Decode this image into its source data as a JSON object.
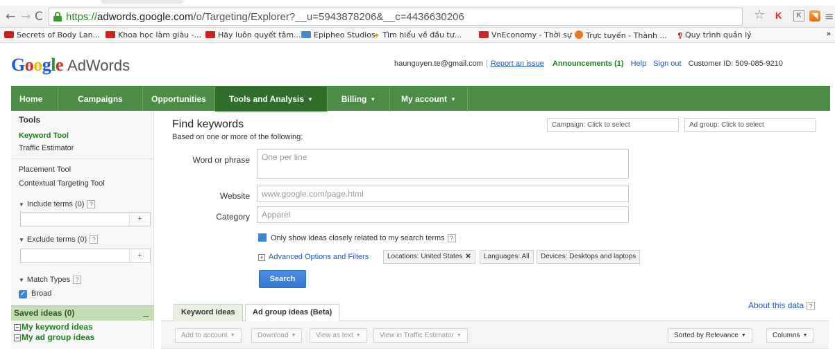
{
  "browser": {
    "url_scheme": "https://",
    "url_host": "adwords.google.com",
    "url_path": "/o/Targeting/Explorer?__u=5943878206&__c=4436630206",
    "bookmarks": [
      "Secrets of Body Lan...",
      "Khoa học làm giàu -...",
      "Hãy luôn quyết tâm...",
      "Epipheo Studios",
      "Tìm hiểu về đầu tư...",
      "VnEconomy - Thời sự",
      "Trực tuyến - Thành ...",
      "Quy trình quản lý"
    ],
    "more": "»"
  },
  "header": {
    "logo_google": "Google",
    "logo_product": "AdWords",
    "email": "haunguyen.te@gmail.com",
    "report_issue": "Report an issue",
    "announcements": "Announcements (1)",
    "help": "Help",
    "sign_out": "Sign out",
    "customer_id": "Customer ID: 509-085-9210"
  },
  "nav": {
    "items": [
      "Home",
      "Campaigns",
      "Opportunities",
      "Tools and Analysis",
      "Billing",
      "My account"
    ],
    "active": "Tools and Analysis"
  },
  "sidebar": {
    "title": "Tools",
    "keyword_tool": "Keyword Tool",
    "traffic_estimator": "Traffic Estimator",
    "placement_tool": "Placement Tool",
    "contextual_tool": "Contextual Targeting Tool",
    "include_terms": "Include terms (0)",
    "exclude_terms": "Exclude terms (0)",
    "plus": "+",
    "match_types": "Match Types",
    "broad": "Broad",
    "help_mark": "?",
    "saved_ideas": "Saved ideas (0)",
    "minimize": "_",
    "my_keyword_ideas": "My keyword ideas",
    "my_ad_group_ideas": "My ad group ideas"
  },
  "main": {
    "title": "Find keywords",
    "subtitle": "Based on one or more of the following:",
    "campaign_select": "Campaign: Click to select",
    "adgroup_select": "Ad group: Click to select",
    "word_label": "Word or phrase",
    "word_placeholder": "One per line",
    "website_label": "Website",
    "website_placeholder": "www.google.com/page.html",
    "category_label": "Category",
    "category_placeholder": "Apparel",
    "closely_related": "Only show ideas closely related to my search terms",
    "advanced": "Advanced Options and Filters",
    "chip_locations": "Locations: United States",
    "chip_languages": "Languages: All",
    "chip_devices": "Devices: Desktops and laptops",
    "search_button": "Search",
    "tab_keyword": "Keyword ideas",
    "tab_adgroup": "Ad group ideas (Beta)",
    "about_data": "About this data",
    "toolbar": {
      "add_to_account": "Add to account",
      "download": "Download",
      "view_as_text": "View as text",
      "view_traffic": "View in Traffic Estimator",
      "sorted": "Sorted by Relevance",
      "columns": "Columns"
    }
  },
  "colors": {
    "nav_green": "#4b8d45",
    "nav_active": "#2f6d2a",
    "link_blue": "#2255cc",
    "accent_green": "#1f7f1f",
    "checkbox_blue": "#3b86d6"
  }
}
